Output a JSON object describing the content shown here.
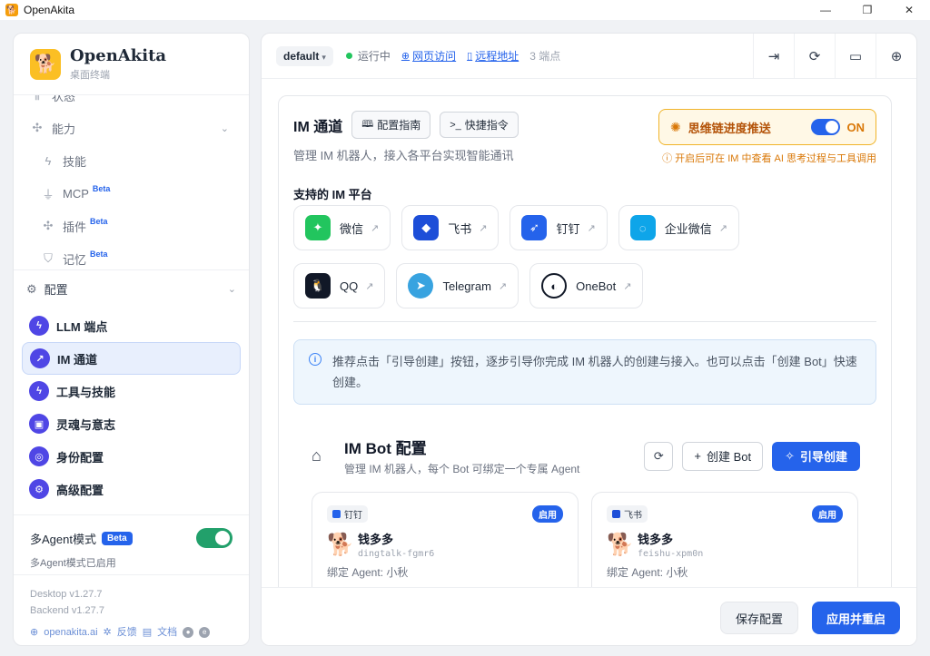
{
  "window": {
    "title": "OpenAkita",
    "controls": {
      "minimize": "—",
      "maximize": "❐",
      "close": "✕"
    }
  },
  "sidebar": {
    "brand_name": "OpenAkita",
    "brand_sub": "桌面终端",
    "scroll_items": [
      {
        "label": "状态",
        "icon": "chart-icon"
      },
      {
        "label": "能力",
        "icon": "puzzle-icon"
      },
      {
        "label": "技能",
        "icon": "lightning-icon"
      },
      {
        "label": "MCP",
        "icon": "plug-icon",
        "badge": "Beta"
      },
      {
        "label": "插件",
        "icon": "puzzle-icon",
        "badge": "Beta"
      },
      {
        "label": "记忆",
        "icon": "shield-icon",
        "badge": "Beta"
      }
    ],
    "config_label": "配置",
    "nav": [
      {
        "label": "LLM 端点",
        "icon": "lightning-icon",
        "active": false
      },
      {
        "label": "IM 通道",
        "icon": "chat-icon",
        "active": true
      },
      {
        "label": "工具与技能",
        "icon": "lightning-icon",
        "active": false
      },
      {
        "label": "灵魂与意志",
        "icon": "robot-icon",
        "active": false
      },
      {
        "label": "身份配置",
        "icon": "fingerprint-icon",
        "active": false
      },
      {
        "label": "高级配置",
        "icon": "gear-icon",
        "active": false
      }
    ],
    "multi_agent": {
      "label": "多Agent模式",
      "badge": "Beta",
      "status": "多Agent模式已启用",
      "enabled": true
    },
    "versions": {
      "desktop": "Desktop v1.27.7",
      "backend": "Backend v1.27.7"
    },
    "links": {
      "site": "openakita.ai",
      "feedback": "反馈",
      "docs": "文档"
    }
  },
  "topbar": {
    "env": "default",
    "status": "运行中",
    "web_link": "网页访问",
    "remote_link": "远程地址",
    "endpoints": "3 端点"
  },
  "im": {
    "title": "IM 通道",
    "guide_btn": "配置指南",
    "cmd_btn": "快捷指令",
    "desc": "管理 IM 机器人，接入各平台实现智能通讯",
    "cot_label": "思维链进度推送",
    "cot_state": "ON",
    "cot_hint": "开启后可在 IM 中查看 AI 思考过程与工具调用",
    "platforms_title": "支持的 IM 平台",
    "platforms_row1": [
      {
        "label": "微信",
        "color": "#22c55e",
        "glyph": "W"
      },
      {
        "label": "飞书",
        "color": "#1d4ed8",
        "glyph": "F"
      },
      {
        "label": "钉钉",
        "color": "#2563eb",
        "glyph": "D"
      },
      {
        "label": "企业微信",
        "color": "#0ea5e9",
        "glyph": "Q"
      }
    ],
    "platforms_row2": [
      {
        "label": "QQ",
        "color": "#111827",
        "glyph": "Q"
      },
      {
        "label": "Telegram",
        "color": "#38a3e0",
        "glyph": "T"
      },
      {
        "label": "OneBot",
        "color": "#111827",
        "glyph": "O"
      }
    ],
    "info": "推荐点击「引导创建」按钮，逐步引导你完成 IM 机器人的创建与接入。也可以点击「创建 Bot」快速创建。"
  },
  "bots": {
    "title": "IM Bot 配置",
    "subtitle": "管理 IM 机器人，每个 Bot 可绑定一个专属 Agent",
    "create_btn": "创建 Bot",
    "guide_btn": "引导创建",
    "cards": [
      {
        "platform": "钉钉",
        "platform_color": "#2563eb",
        "status": "启用",
        "name": "钱多多",
        "id": "dingtalk-fgmr6",
        "agent": "绑定 Agent: 小秋"
      },
      {
        "platform": "飞书",
        "platform_color": "#1d4ed8",
        "status": "启用",
        "name": "钱多多",
        "id": "feishu-xpm0n",
        "agent": "绑定 Agent: 小秋"
      }
    ]
  },
  "footer": {
    "save": "保存配置",
    "apply": "应用并重启"
  }
}
